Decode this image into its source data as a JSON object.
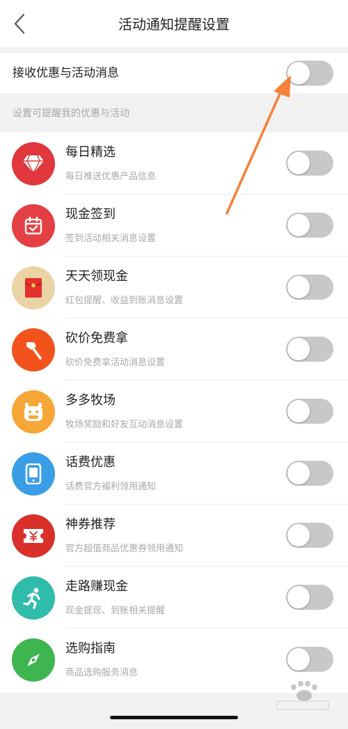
{
  "header": {
    "title": "活动通知提醒设置",
    "back_icon": "chevron-left-icon"
  },
  "master": {
    "label": "接收优惠与活动消息",
    "enabled": false
  },
  "section_caption": "设置可提醒我的优惠与活动",
  "items": [
    {
      "title": "每日精选",
      "subtitle": "每日推送优惠产品信息",
      "icon": "diamond-icon",
      "color": "#e0383d",
      "enabled": false
    },
    {
      "title": "现金签到",
      "subtitle": "签到活动相关消息设置",
      "icon": "calendar-check-icon",
      "color": "#e43f44",
      "enabled": false
    },
    {
      "title": "天天领现金",
      "subtitle": "红包提醒、收益到账消息设置",
      "icon": "red-envelope-icon",
      "color": "#ead4a4",
      "enabled": false
    },
    {
      "title": "砍价免费拿",
      "subtitle": "砍价免费拿活动消息设置",
      "icon": "axe-icon",
      "color": "#f2531d",
      "enabled": false
    },
    {
      "title": "多多牧场",
      "subtitle": "牧场奖励和好友互动消息设置",
      "icon": "cow-icon",
      "color": "#f7a638",
      "enabled": false
    },
    {
      "title": "话费优惠",
      "subtitle": "话费官方福利领用通知",
      "icon": "phone-icon",
      "color": "#3a9ee6",
      "enabled": false
    },
    {
      "title": "神券推荐",
      "subtitle": "官方超值商品优惠券领用通知",
      "icon": "coupon-icon",
      "color": "#d9302a",
      "enabled": false
    },
    {
      "title": "走路赚现金",
      "subtitle": "现金提现、到账相关提醒",
      "icon": "running-person-icon",
      "color": "#2fbcaa",
      "enabled": false
    },
    {
      "title": "选购指南",
      "subtitle": "商品选购服务消息",
      "icon": "compass-icon",
      "color": "#3fb550",
      "enabled": false
    }
  ],
  "colors": {
    "toggle_off": "#c8c8c8",
    "arrow": "#f5813a"
  }
}
